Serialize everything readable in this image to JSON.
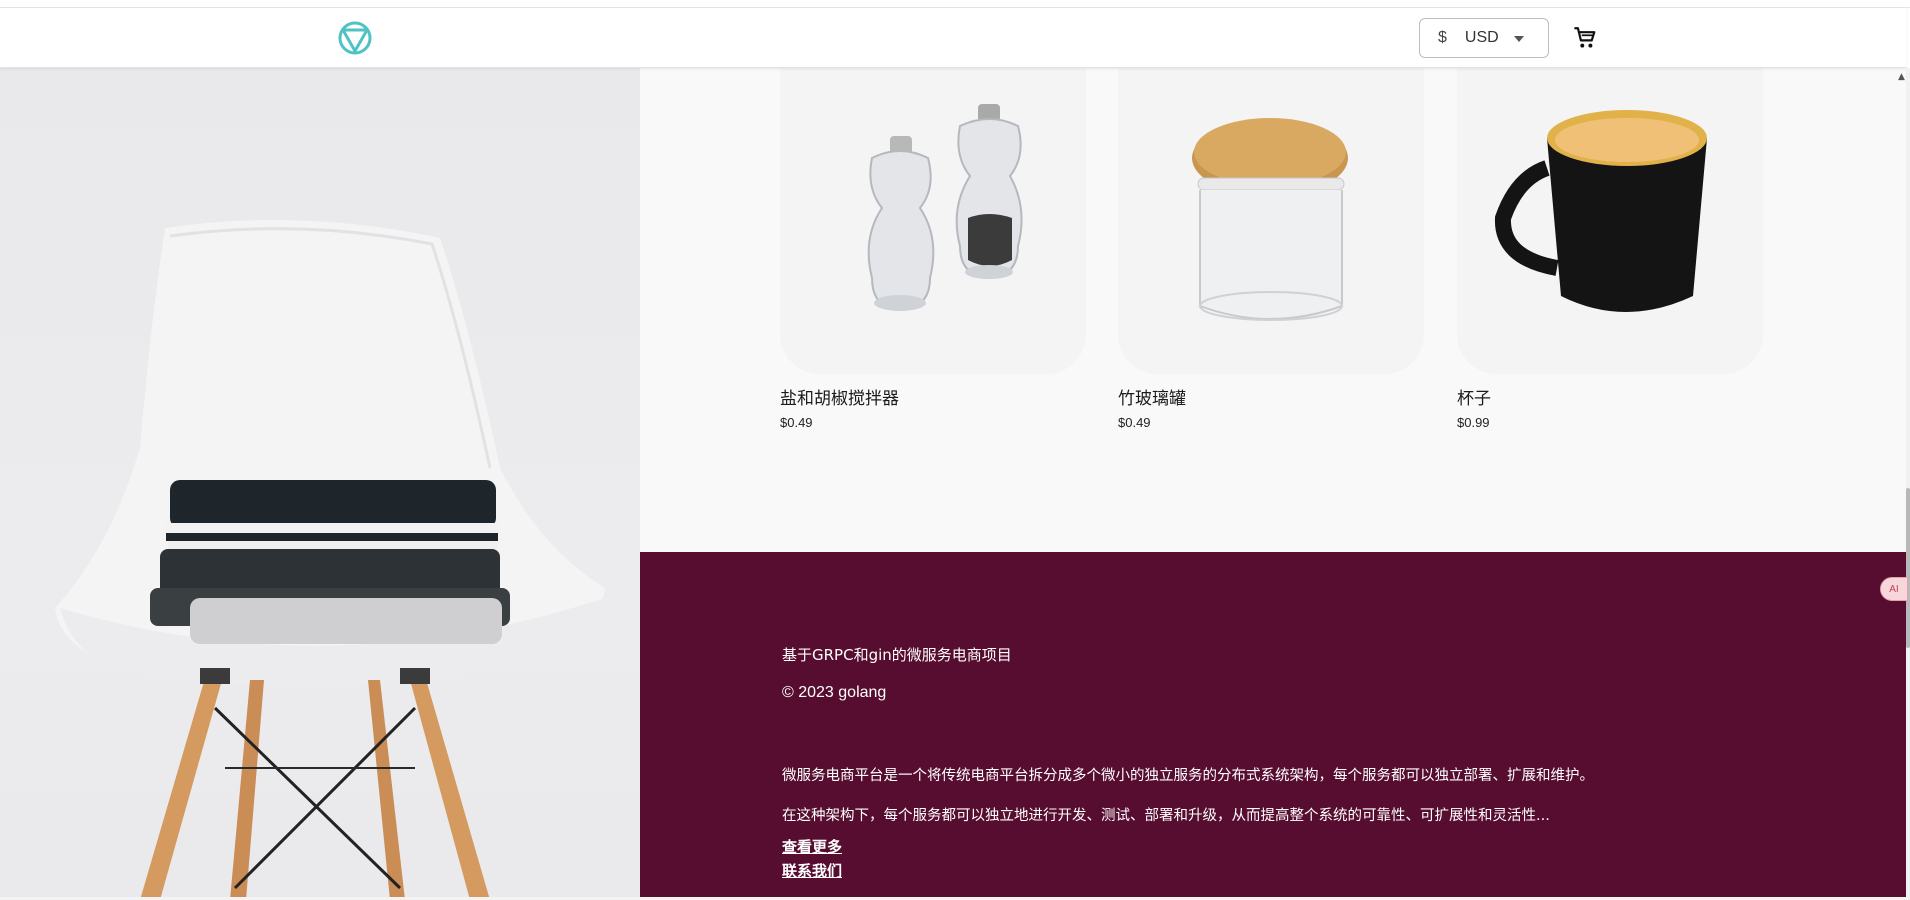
{
  "header": {
    "logo_icon": "brand-triangle-circle-logo",
    "currency": {
      "symbol": "$",
      "selected": "USD"
    },
    "cart_icon": "cart-icon",
    "accent_color": "#4fc3c3"
  },
  "products": [
    {
      "name": "盐和胡椒搅拌器",
      "price": "$0.49",
      "image": "salt-pepper-shakers"
    },
    {
      "name": "竹玻璃罐",
      "price": "$0.49",
      "image": "bamboo-glass-jar"
    },
    {
      "name": "杯子",
      "price": "$0.99",
      "image": "black-mug"
    }
  ],
  "footer": {
    "background": "#570d30",
    "project_line": "基于GRPC和gin的微服务电商项目",
    "copyright": "© 2023 golang",
    "desc_1": "微服务电商平台是一个将传统电商平台拆分成多个微小的独立服务的分布式系统架构，每个服务都可以独立部署、扩展和维护。",
    "desc_2": "在这种架构下，每个服务都可以独立地进行开发、测试、部署和升级，从而提高整个系统的可靠性、可扩展性和灵活性...",
    "more_link": "查看更多",
    "contact_link": "联系我们"
  },
  "badges": {
    "ai": "AI"
  }
}
